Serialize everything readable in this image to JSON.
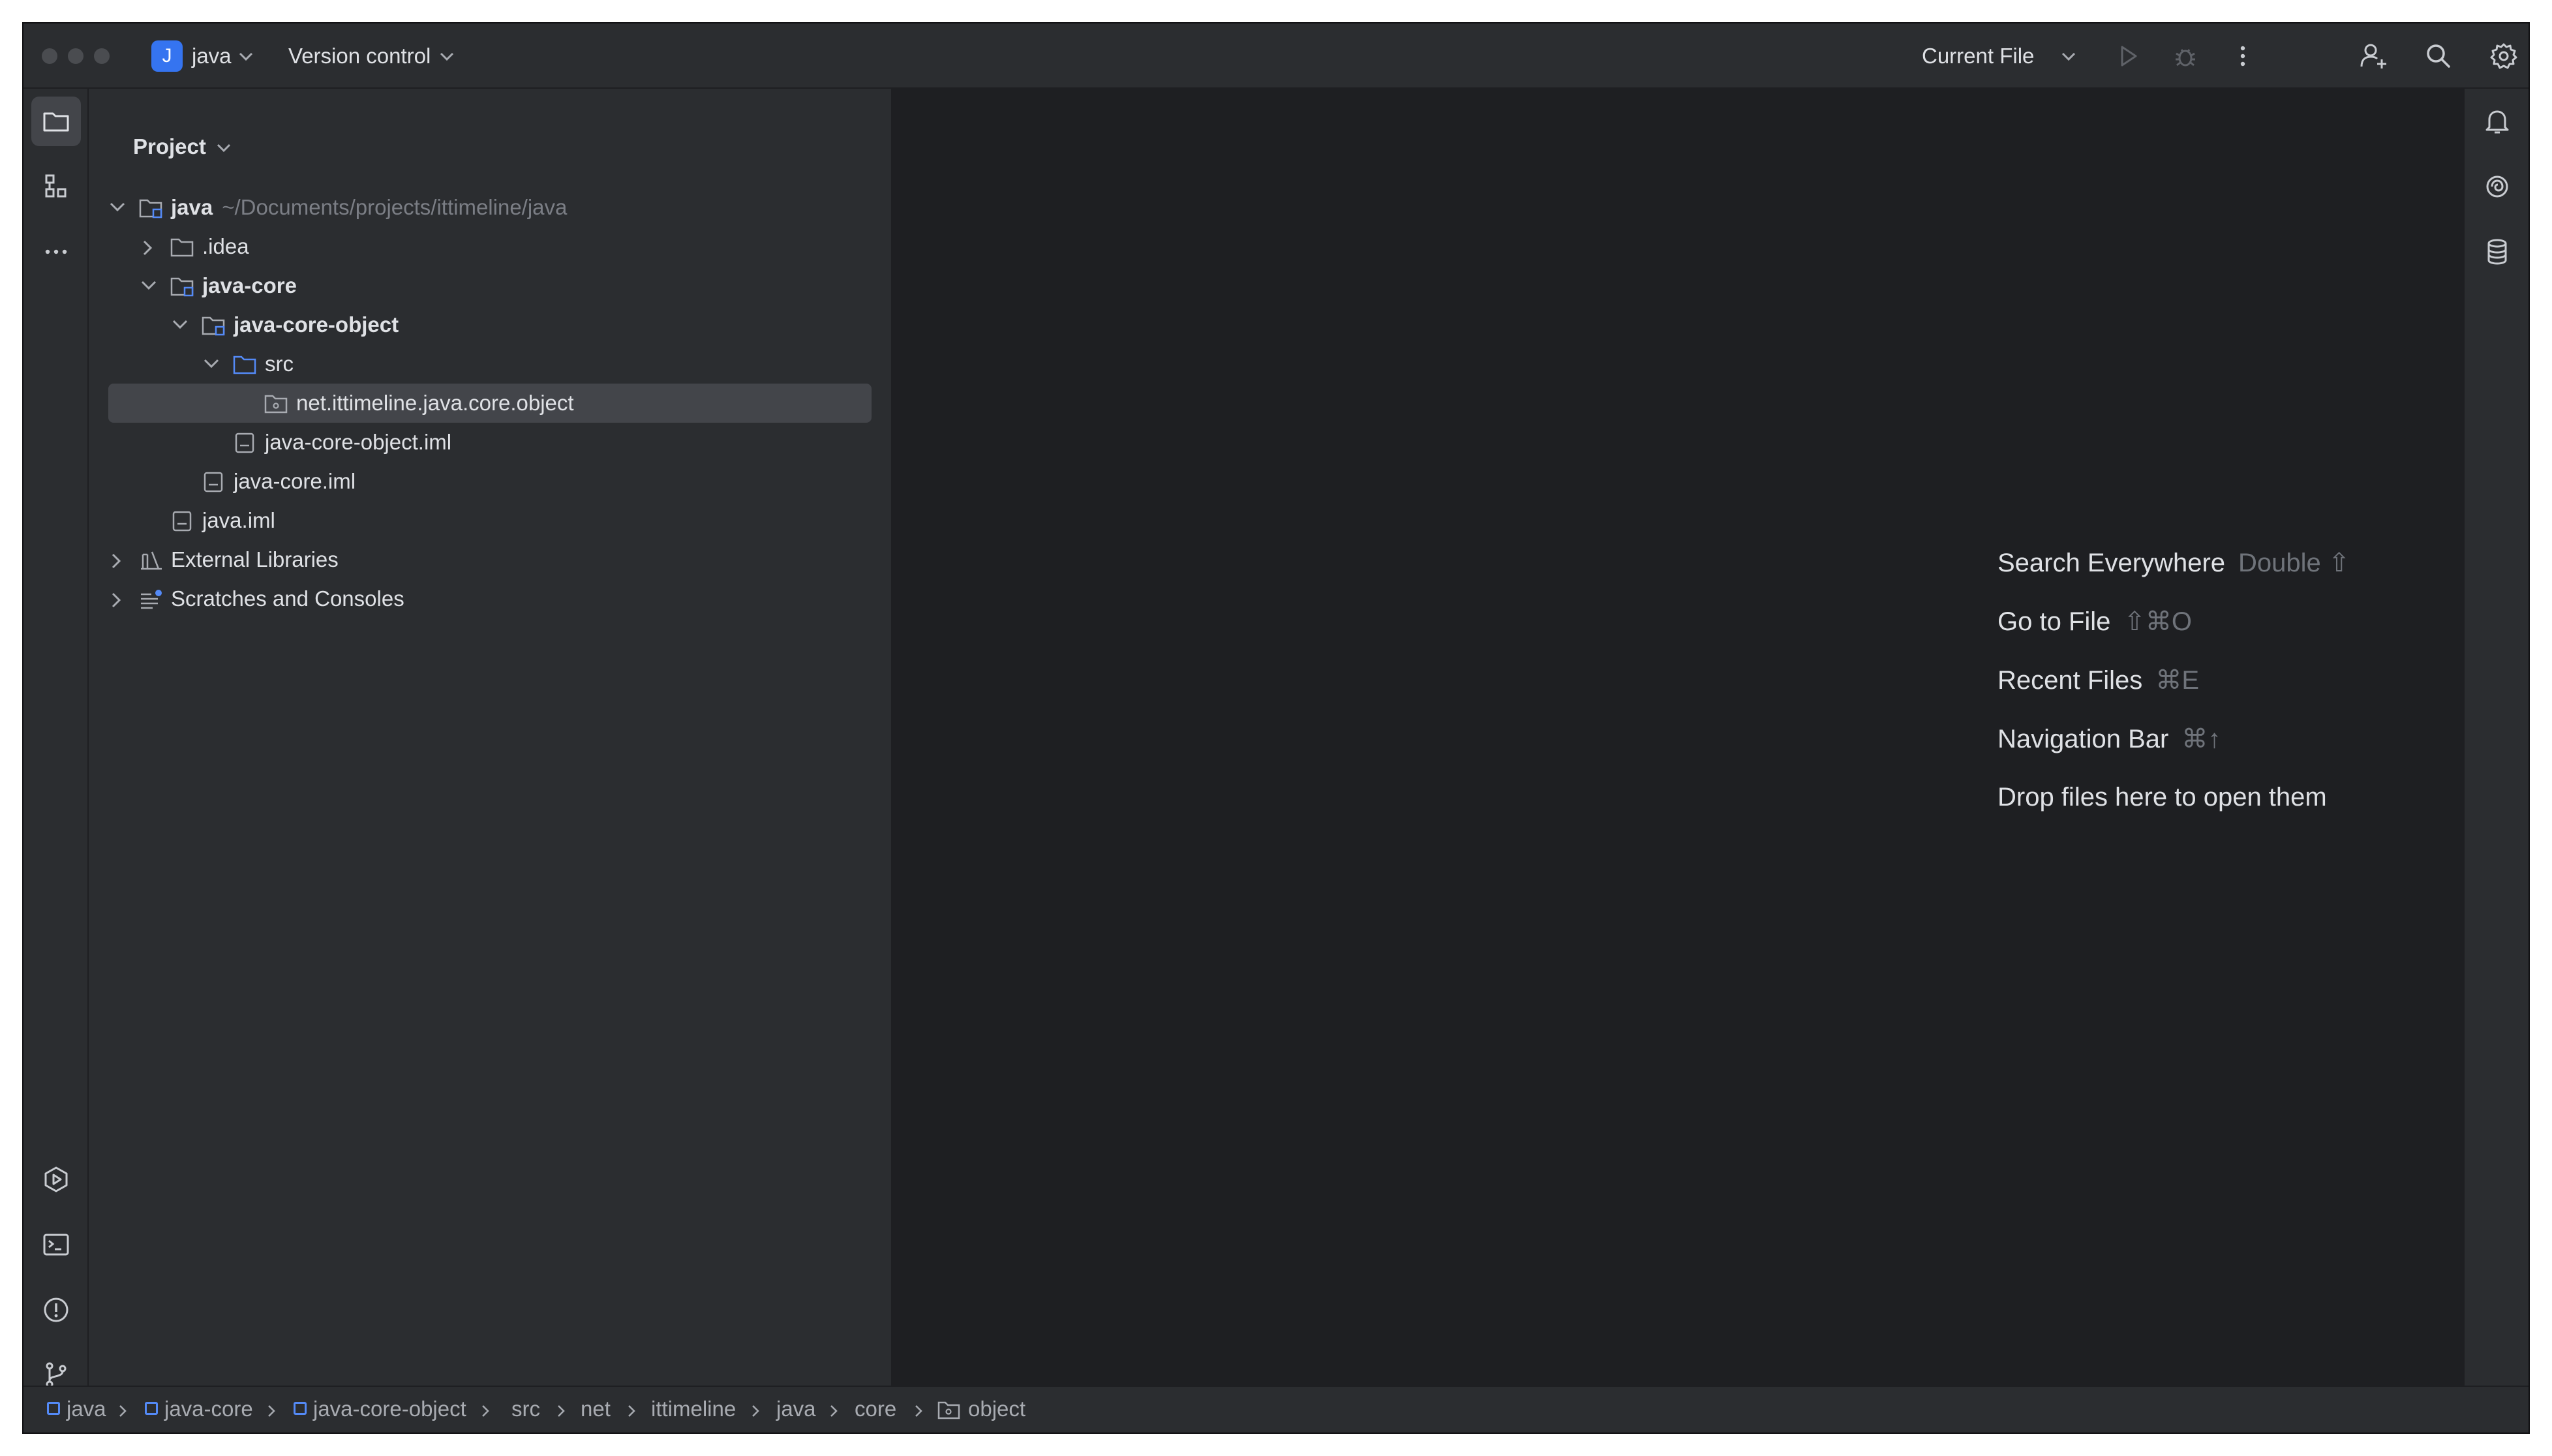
{
  "titlebar": {
    "project_badge": "J",
    "project_name": "java",
    "vcs_label": "Version control",
    "run_config": "Current File",
    "icons": [
      "run-icon",
      "debug-icon",
      "more-vertical-icon",
      "add-user-icon",
      "search-icon",
      "settings-icon"
    ]
  },
  "left_strip": {
    "top": [
      "project-folder-icon",
      "structure-icon",
      "more-horizontal-icon"
    ],
    "bottom": [
      "run-services-icon",
      "terminal-icon",
      "problems-icon",
      "git-branch-icon"
    ]
  },
  "right_strip": [
    "notifications-icon",
    "ai-assistant-icon",
    "database-icon"
  ],
  "project_panel": {
    "title": "Project",
    "tree": [
      {
        "label": "java",
        "path": "~/Documents/projects/ittimeline/java",
        "bold": true,
        "expanded": true,
        "icon": "module-folder"
      },
      {
        "label": ".idea",
        "bold": false,
        "expanded": false,
        "icon": "folder"
      },
      {
        "label": "java-core",
        "bold": true,
        "expanded": true,
        "icon": "module-folder"
      },
      {
        "label": "java-core-object",
        "bold": true,
        "expanded": true,
        "icon": "module-folder"
      },
      {
        "label": "src",
        "bold": false,
        "expanded": true,
        "icon": "source-folder"
      },
      {
        "label": "net.ittimeline.java.core.object",
        "bold": false,
        "selected": true,
        "icon": "package"
      },
      {
        "label": "java-core-object.iml",
        "bold": false,
        "icon": "iml-file"
      },
      {
        "label": "java-core.iml",
        "bold": false,
        "icon": "iml-file"
      },
      {
        "label": "java.iml",
        "bold": false,
        "icon": "iml-file"
      },
      {
        "label": "External Libraries",
        "bold": false,
        "expanded": false,
        "icon": "library"
      },
      {
        "label": "Scratches and Consoles",
        "bold": false,
        "expanded": false,
        "icon": "scratches"
      }
    ]
  },
  "editor_hints": [
    {
      "label": "Search Everywhere",
      "key": "Double ⇧"
    },
    {
      "label": "Go to File",
      "key": "⇧⌘O"
    },
    {
      "label": "Recent Files",
      "key": "⌘E"
    },
    {
      "label": "Navigation Bar",
      "key": "⌘↑"
    },
    {
      "label": "Drop files here to open them",
      "key": ""
    }
  ],
  "breadcrumbs": [
    "java",
    "java-core",
    "java-core-object",
    "src",
    "net",
    "ittimeline",
    "java",
    "core",
    "object"
  ]
}
